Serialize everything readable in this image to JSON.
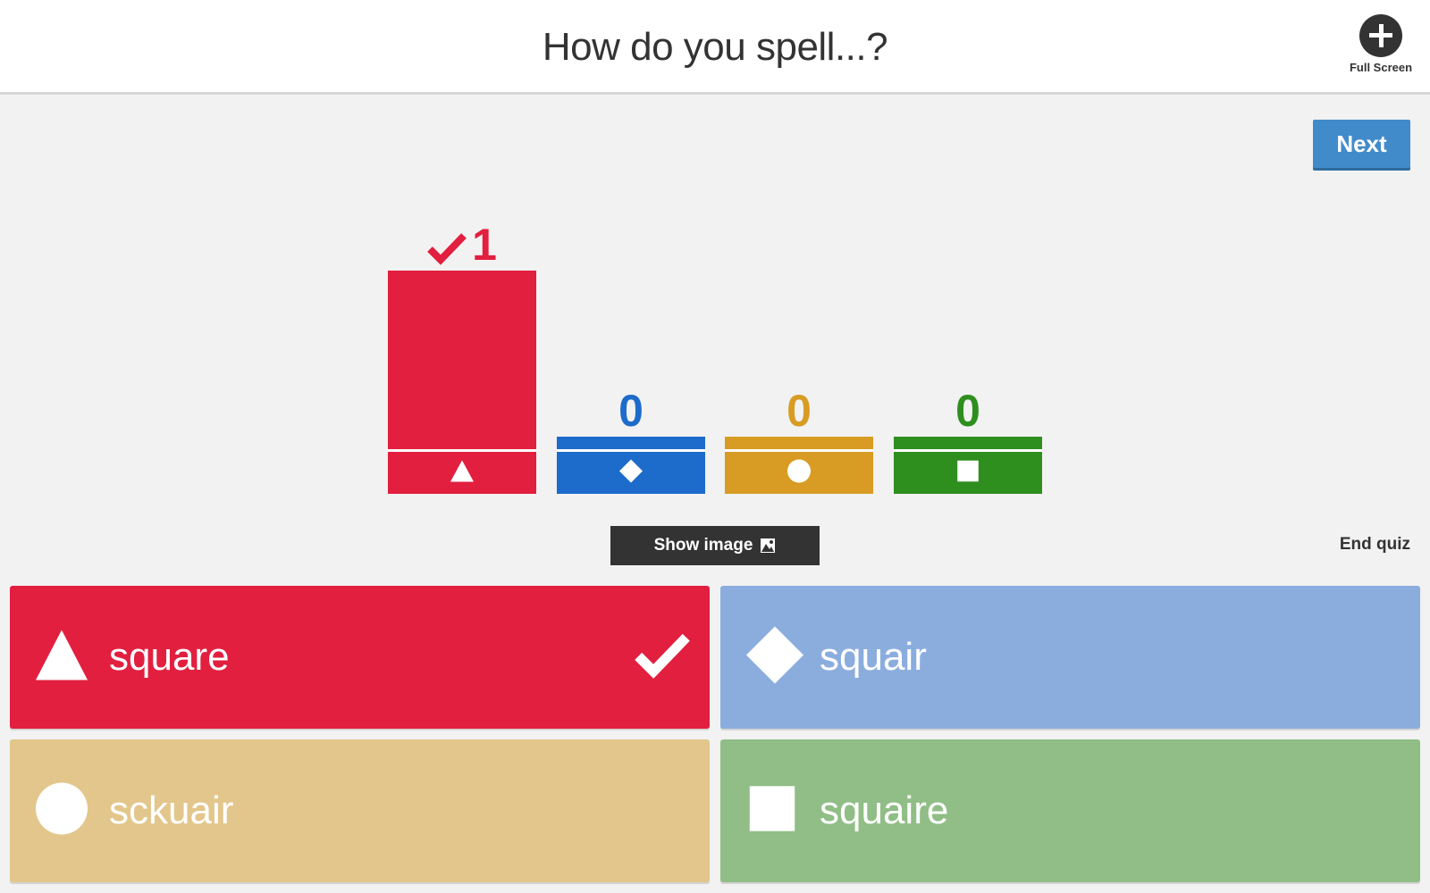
{
  "header": {
    "question": "How do you spell...?",
    "fullscreen_label": "Full Screen"
  },
  "controls": {
    "next_label": "Next",
    "show_image_label": "Show image",
    "end_quiz_label": "End quiz"
  },
  "results": {
    "bars": [
      {
        "shape": "triangle-icon",
        "count": 1,
        "color": "#e21f3f",
        "correct": true
      },
      {
        "shape": "diamond-icon",
        "count": 0,
        "color": "#1d6bca",
        "correct": false
      },
      {
        "shape": "circle-icon",
        "count": 0,
        "color": "#d89c24",
        "correct": false
      },
      {
        "shape": "square-icon",
        "count": 0,
        "color": "#2e8f1f",
        "correct": false
      }
    ]
  },
  "answers": [
    {
      "text": "square",
      "shape": "triangle-icon",
      "color": "#e21f3f",
      "correct": true
    },
    {
      "text": "squair",
      "shape": "diamond-icon",
      "color": "#8badde",
      "correct": false
    },
    {
      "text": "sckuair",
      "shape": "circle-icon",
      "color": "#e3c68b",
      "correct": false
    },
    {
      "text": "squaire",
      "shape": "square-icon",
      "color": "#90be86",
      "correct": false
    }
  ]
}
